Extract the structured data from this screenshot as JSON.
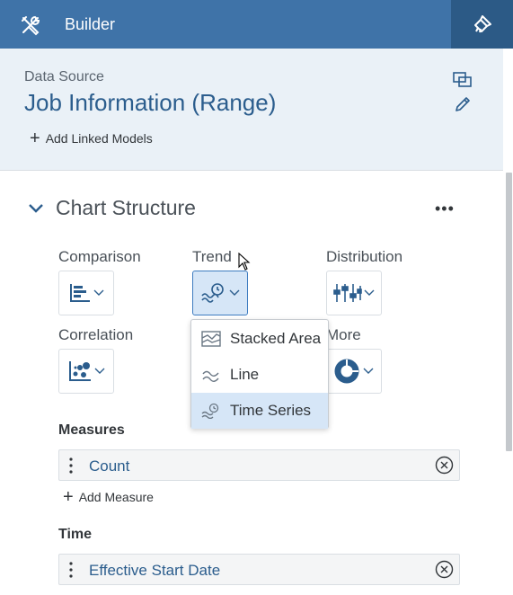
{
  "header": {
    "title": "Builder",
    "left_icon": "tools-icon",
    "right_icon": "styling-brush-icon"
  },
  "data_source": {
    "label": "Data Source",
    "title": "Job Information (Range)",
    "add_linked_models": "Add Linked Models",
    "icons": [
      "copy-icon",
      "edit-pencil-icon"
    ]
  },
  "chart_structure": {
    "label": "Chart Structure",
    "more_label": "•••",
    "categories": [
      {
        "label": "Comparison",
        "icon": "bar-chart-icon"
      },
      {
        "label": "Trend",
        "icon": "time-series-icon",
        "active": true
      },
      {
        "label": "Distribution",
        "icon": "box-plot-icon"
      },
      {
        "label": "Correlation",
        "icon": "scatter-icon"
      },
      {
        "label": "More",
        "icon": "donut-icon"
      }
    ],
    "trend_menu": [
      {
        "label": "Stacked Area",
        "icon": "stacked-area-icon"
      },
      {
        "label": "Line",
        "icon": "line-icon"
      },
      {
        "label": "Time Series",
        "icon": "time-series-icon",
        "selected": true
      }
    ]
  },
  "measures": {
    "label": "Measures",
    "items": [
      {
        "value": "Count"
      }
    ],
    "add_label": "Add Measure"
  },
  "time": {
    "label": "Time",
    "items": [
      {
        "value": "Effective Start Date"
      }
    ]
  },
  "colors": {
    "header": "#3f73a8",
    "header_tab": "#2c5a86",
    "panel": "#eaf1f7",
    "accent_text": "#2b5d8d",
    "selected": "#d6e6f7"
  }
}
